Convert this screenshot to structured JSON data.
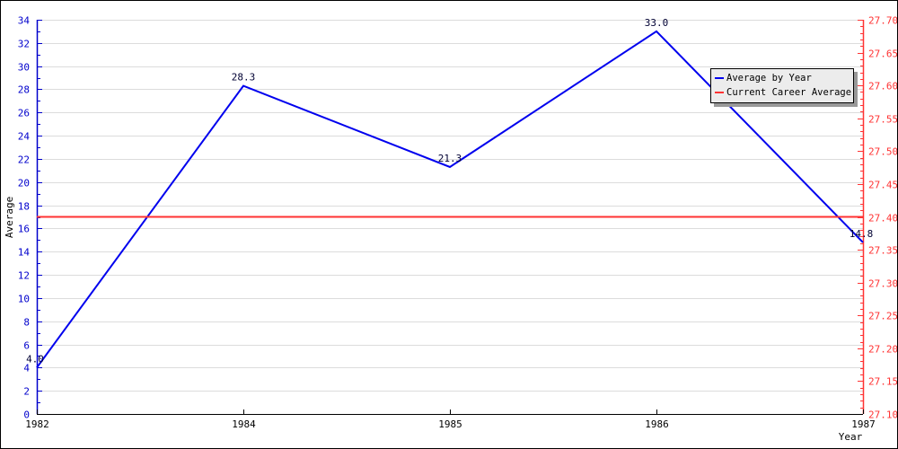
{
  "chart_data": {
    "type": "line",
    "title": "",
    "xlabel": "Year",
    "ylabel": "Average",
    "categories": [
      "1982",
      "1984",
      "1985",
      "1986",
      "1987"
    ],
    "series": [
      {
        "name": "Average by Year",
        "axis": "left",
        "color": "#0000ee",
        "values": [
          4.0,
          28.3,
          21.3,
          33.0,
          14.8
        ],
        "labels": [
          "4.0",
          "28.3",
          "21.3",
          "33.0",
          "14.8"
        ]
      },
      {
        "name": "Current Career Average",
        "axis": "right",
        "color": "#ff3333",
        "values": [
          27.4,
          27.4,
          27.4,
          27.4,
          27.4
        ]
      }
    ],
    "y_left": {
      "range": [
        0,
        34
      ],
      "ticks": [
        0,
        2,
        4,
        6,
        8,
        10,
        12,
        14,
        16,
        18,
        20,
        22,
        24,
        26,
        28,
        30,
        32,
        34
      ],
      "color": "#0000cc"
    },
    "y_right": {
      "range": [
        27.1,
        27.7
      ],
      "ticks": [
        "27.10",
        "27.15",
        "27.20",
        "27.25",
        "27.30",
        "27.35",
        "27.40",
        "27.45",
        "27.50",
        "27.55",
        "27.60",
        "27.65",
        "27.70"
      ],
      "color": "#ff3333"
    },
    "grid": true,
    "legend": {
      "placement": "top-right",
      "entries": [
        "Average by Year",
        "Current Career Average"
      ]
    }
  }
}
